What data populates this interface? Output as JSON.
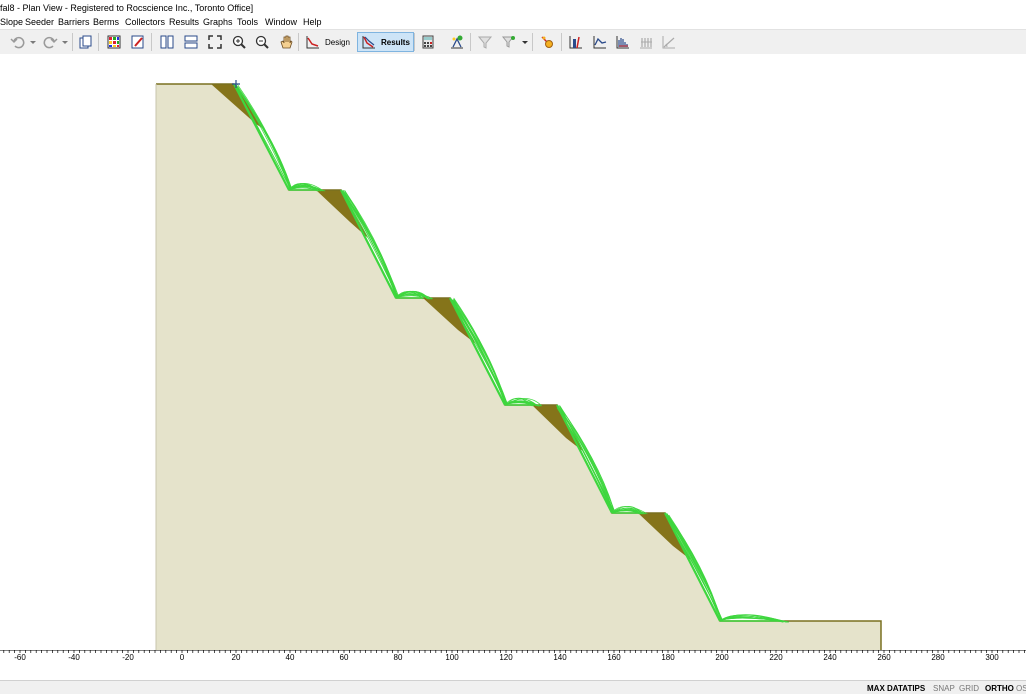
{
  "window": {
    "title": "fal8 - Plan View - Registered to Rocscience Inc., Toronto Office]"
  },
  "menu": [
    "Slope",
    "Seeder",
    "Barriers",
    "Berms",
    "Collectors",
    "Results",
    "Graphs",
    "Tools",
    "Window",
    "Help"
  ],
  "toolbar": {
    "icons": [
      "undo-icon",
      "redo-icon",
      "copy-icon",
      "grid-icon",
      "edit-icon",
      "tile-vertical-icon",
      "tile-horizontal-icon",
      "zoom-extents-icon",
      "zoom-in-icon",
      "zoom-out-icon",
      "pan-icon",
      "design-icon",
      "results-icon",
      "calculator-icon",
      "seeder-icon",
      "filter-icon",
      "filter-dropdown-icon",
      "rock-path-icon",
      "histogram-icon",
      "line-graph-icon",
      "bar-graph-icon",
      "barrier-graph-icon",
      "angle-graph-icon"
    ],
    "design_label": "Design",
    "results_label": "Results",
    "active_mode": "Results"
  },
  "ruler": {
    "ticks": [
      "-60",
      "-40",
      "-20",
      "0",
      "20",
      "40",
      "60",
      "80",
      "100",
      "120",
      "140",
      "160",
      "180",
      "200",
      "220",
      "240",
      "260",
      "280",
      "300"
    ]
  },
  "status": {
    "max_datatips": "MAX DATATIPS",
    "snap": "SNAP",
    "grid": "GRID",
    "ortho": "ORTHO",
    "osnap": "OS"
  },
  "model": {
    "slope_color": "#e5e3cb",
    "outline_color": "#7a7020",
    "deposit_color": "#85741a",
    "trajectory_color": "#3ed63e"
  }
}
